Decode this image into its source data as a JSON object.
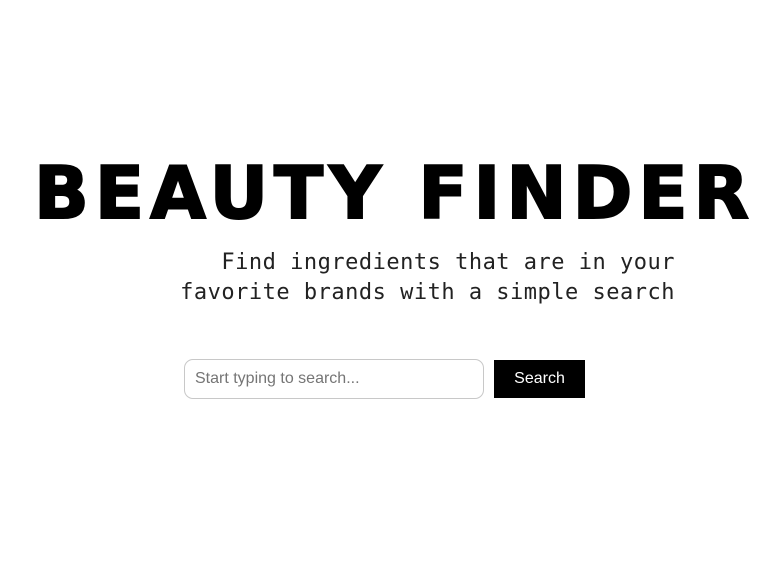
{
  "header": {
    "logo_text": "BEAUTY FINDER",
    "tagline_line1": "Find ingredients that are in your",
    "tagline_line2": "favorite brands with a simple search"
  },
  "search": {
    "placeholder": "Start typing to search...",
    "value": "",
    "button_label": "Search"
  },
  "colors": {
    "background": "#ffffff",
    "text": "#000000",
    "button_background": "#000000",
    "button_text": "#ffffff",
    "input_border": "#c8c8c8"
  }
}
